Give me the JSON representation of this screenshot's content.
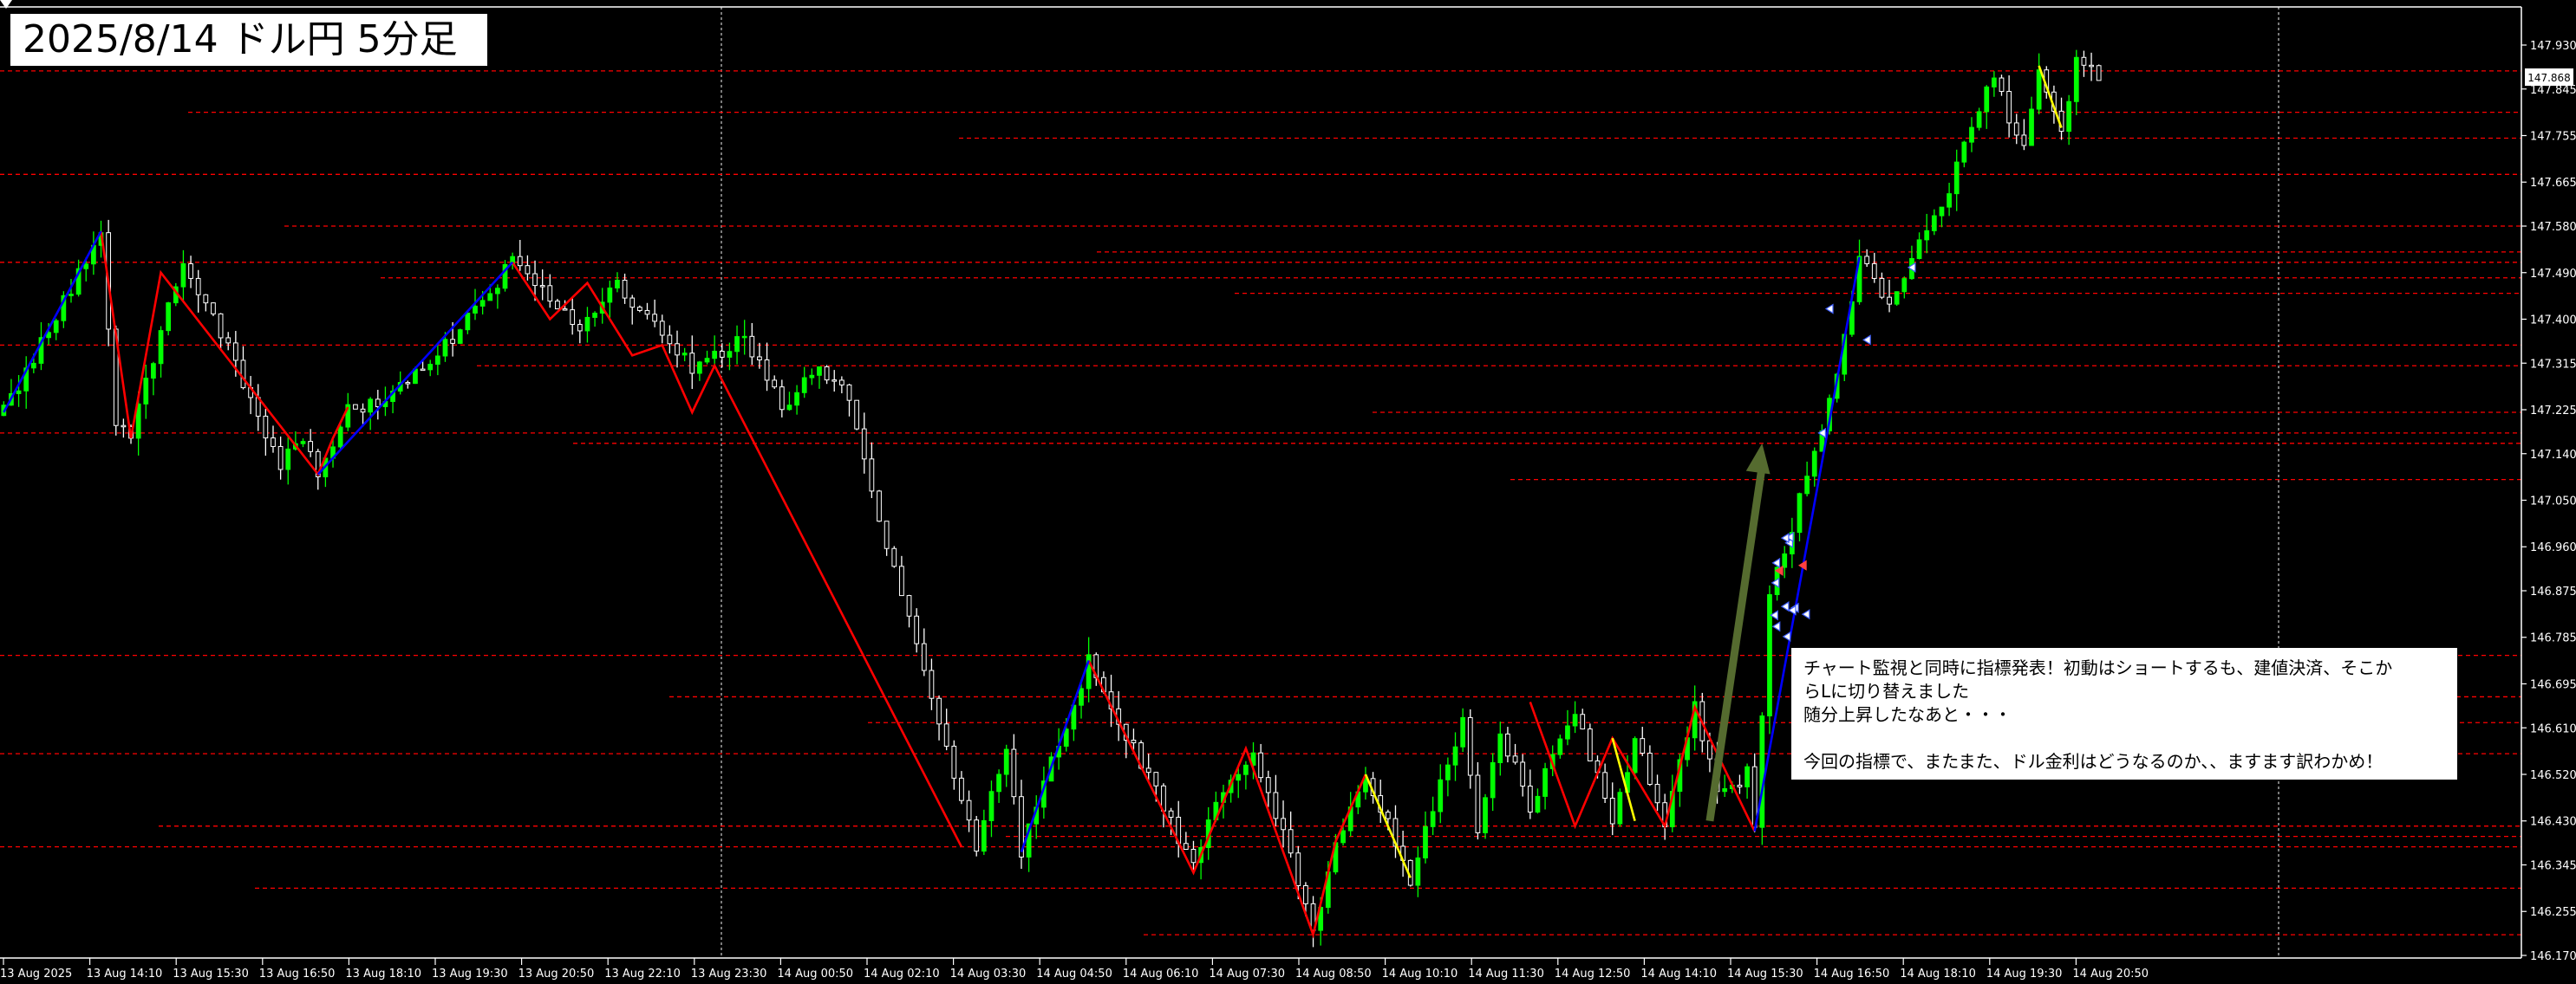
{
  "title": "2025/8/14 ドル円 5分足",
  "note": {
    "line1": "チャート監視と同時に指標発表！初動はショートするも、建値決済、そこか",
    "line2": "らLに切り替えました",
    "line3": "随分上昇したなあと・・・",
    "line4": "今回の指標で、またまた、ドル金利はどうなるのか、、ますます訳わかめ！"
  },
  "current_price_label": "147.868",
  "colors": {
    "background": "#000000",
    "bull_candle": "#00ff00",
    "bear_candle": "#ffffff",
    "grid": "#ffffff",
    "support_resistance": "#ff0000",
    "zigzag_down": "#ff0000",
    "zigzag_up": "#0000ff",
    "zigzag_yellow": "#ffff00",
    "arrow": "#556b2f"
  },
  "chart_data": {
    "type": "candlestick",
    "symbol": "USDJPY",
    "timeframe": "M5",
    "ylim": [
      146.17,
      147.96
    ],
    "y_ticks": [
      "147.930",
      "147.845",
      "147.755",
      "147.665",
      "147.580",
      "147.490",
      "147.400",
      "147.315",
      "147.225",
      "147.140",
      "147.050",
      "146.960",
      "146.875",
      "146.785",
      "146.695",
      "146.610",
      "146.520",
      "146.430",
      "146.345",
      "146.255",
      "146.170"
    ],
    "x_ticks": [
      "13 Aug 2025",
      "13 Aug 14:10",
      "13 Aug 15:30",
      "13 Aug 16:50",
      "13 Aug 18:10",
      "13 Aug 19:30",
      "13 Aug 20:50",
      "13 Aug 22:10",
      "13 Aug 23:30",
      "14 Aug 00:50",
      "14 Aug 02:10",
      "14 Aug 03:30",
      "14 Aug 04:50",
      "14 Aug 06:10",
      "14 Aug 07:30",
      "14 Aug 08:50",
      "14 Aug 10:10",
      "14 Aug 11:30",
      "14 Aug 12:50",
      "14 Aug 14:10",
      "14 Aug 15:30",
      "14 Aug 16:50",
      "14 Aug 18:10",
      "14 Aug 19:30",
      "14 Aug 20:50"
    ],
    "grid": "vertical dashed at 13 Aug 23:30 and after last bar",
    "path": [
      [
        0,
        147.22
      ],
      [
        5,
        147.35
      ],
      [
        10,
        147.49
      ],
      [
        13,
        147.57
      ],
      [
        15,
        147.2
      ],
      [
        17,
        147.17
      ],
      [
        21,
        147.38
      ],
      [
        24,
        147.5
      ],
      [
        28,
        147.41
      ],
      [
        33,
        147.25
      ],
      [
        37,
        147.12
      ],
      [
        40,
        147.17
      ],
      [
        42,
        147.1
      ],
      [
        46,
        147.22
      ],
      [
        52,
        147.25
      ],
      [
        58,
        147.33
      ],
      [
        63,
        147.42
      ],
      [
        68,
        147.51
      ],
      [
        73,
        147.44
      ],
      [
        77,
        147.39
      ],
      [
        82,
        147.47
      ],
      [
        86,
        147.4
      ],
      [
        92,
        147.31
      ],
      [
        99,
        147.36
      ],
      [
        104,
        147.23
      ],
      [
        108,
        147.3
      ],
      [
        112,
        147.28
      ],
      [
        119,
        146.92
      ],
      [
        124,
        146.66
      ],
      [
        130,
        146.38
      ],
      [
        134,
        146.57
      ],
      [
        136,
        146.37
      ],
      [
        139,
        146.5
      ],
      [
        145,
        146.74
      ],
      [
        151,
        146.57
      ],
      [
        159,
        146.34
      ],
      [
        162,
        146.47
      ],
      [
        167,
        146.57
      ],
      [
        172,
        146.36
      ],
      [
        175,
        146.22
      ],
      [
        178,
        146.39
      ],
      [
        182,
        146.52
      ],
      [
        188,
        146.32
      ],
      [
        191,
        146.46
      ],
      [
        195,
        146.63
      ],
      [
        197,
        146.42
      ],
      [
        200,
        146.6
      ],
      [
        204,
        146.46
      ],
      [
        210,
        146.65
      ],
      [
        215,
        146.42
      ],
      [
        218,
        146.59
      ],
      [
        222,
        146.43
      ],
      [
        226,
        146.65
      ],
      [
        229,
        146.48
      ],
      [
        233,
        146.52
      ],
      [
        234,
        146.41
      ],
      [
        236,
        146.88
      ],
      [
        239,
        147.0
      ],
      [
        245,
        147.29
      ],
      [
        248,
        147.52
      ],
      [
        252,
        147.42
      ],
      [
        256,
        147.55
      ],
      [
        259,
        147.61
      ],
      [
        263,
        147.77
      ],
      [
        266,
        147.88
      ],
      [
        268,
        147.78
      ],
      [
        270,
        147.75
      ],
      [
        272,
        147.89
      ],
      [
        275,
        147.77
      ],
      [
        277,
        147.9
      ],
      [
        280,
        147.87
      ]
    ],
    "bar_count": 281,
    "support_resistance_levels": [
      147.88,
      147.8,
      147.75,
      147.68,
      147.58,
      147.53,
      147.51,
      147.48,
      147.45,
      147.35,
      147.31,
      147.22,
      147.18,
      147.16,
      147.09,
      146.75,
      146.67,
      146.62,
      146.56,
      146.42,
      146.4,
      146.38,
      146.3,
      146.21
    ],
    "zigzag": [
      {
        "color": "#ff0000",
        "points": [
          [
            13,
            147.57
          ],
          [
            17,
            147.17
          ],
          [
            21,
            147.49
          ],
          [
            42,
            147.1
          ],
          [
            44,
            147.17
          ],
          [
            46,
            147.23
          ]
        ]
      },
      {
        "color": "#ff0000",
        "points": [
          [
            68,
            147.51
          ],
          [
            73,
            147.4
          ],
          [
            78,
            147.47
          ],
          [
            84,
            147.33
          ],
          [
            88,
            147.35
          ],
          [
            92,
            147.22
          ],
          [
            95,
            147.31
          ],
          [
            128,
            146.38
          ]
        ]
      },
      {
        "color": "#ff0000",
        "points": [
          [
            145,
            146.74
          ],
          [
            159,
            146.33
          ],
          [
            166,
            146.57
          ],
          [
            175,
            146.21
          ],
          [
            178,
            146.39
          ],
          [
            182,
            146.52
          ]
        ]
      },
      {
        "color": "#ff0000",
        "points": [
          [
            204,
            146.66
          ],
          [
            210,
            146.42
          ],
          [
            215,
            146.59
          ],
          [
            222,
            146.42
          ],
          [
            226,
            146.65
          ],
          [
            234,
            146.41
          ]
        ]
      },
      {
        "color": "#0000ff",
        "points": [
          [
            136,
            146.37
          ],
          [
            145,
            146.74
          ]
        ]
      },
      {
        "color": "#0000ff",
        "points": [
          [
            234,
            146.41
          ],
          [
            248,
            147.52
          ]
        ]
      },
      {
        "color": "#0000ff",
        "points": [
          [
            0,
            147.22
          ],
          [
            13,
            147.57
          ]
        ]
      },
      {
        "color": "#0000ff",
        "points": [
          [
            42,
            147.1
          ],
          [
            68,
            147.51
          ]
        ]
      },
      {
        "color": "#ffff00",
        "points": [
          [
            182,
            146.52
          ],
          [
            188,
            146.32
          ]
        ]
      },
      {
        "color": "#ffff00",
        "points": [
          [
            215,
            146.59
          ],
          [
            218,
            146.43
          ]
        ]
      },
      {
        "color": "#ffff00",
        "points": [
          [
            272,
            147.89
          ],
          [
            275,
            147.77
          ]
        ]
      }
    ],
    "annotation_arrow": {
      "from": [
        228,
        146.43
      ],
      "to": [
        235,
        147.16
      ]
    },
    "signal_markers_range": {
      "x": [
        236,
        241
      ],
      "y": [
        146.78,
        147.0
      ]
    }
  }
}
